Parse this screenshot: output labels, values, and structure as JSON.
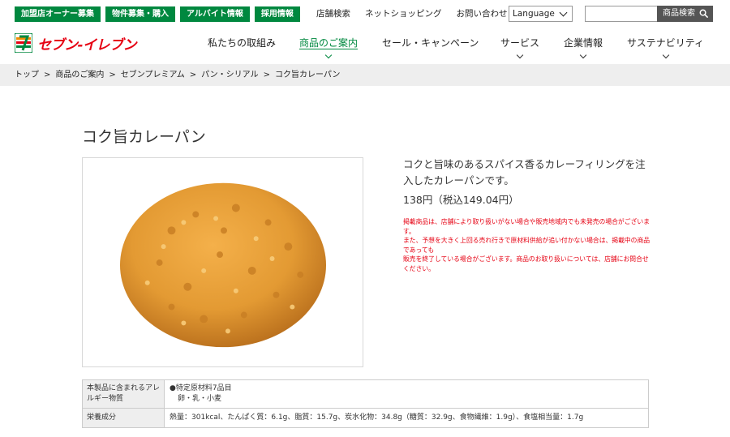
{
  "topbar": {
    "buttons": [
      "加盟店オーナー募集",
      "物件募集・購入",
      "アルバイト情報",
      "採用情報"
    ],
    "links": [
      "店舗検索",
      "ネットショッピング",
      "お問い合わせ"
    ],
    "language_label": "Language",
    "search_placeholder": "",
    "search_button_label": "商品検索"
  },
  "brand": {
    "logo_text": "セブン-イレブン",
    "logo_color": "#e60012",
    "accent_green": "#00883f"
  },
  "nav": {
    "items": [
      "私たちの取組み",
      "商品のご案内",
      "セール・キャンペーン",
      "サービス",
      "企業情報",
      "サステナビリティ"
    ],
    "active_index": 1
  },
  "breadcrumb": [
    "トップ",
    "商品のご案内",
    "セブンプレミアム",
    "パン・シリアル",
    "コク旨カレーパン"
  ],
  "product": {
    "title": "コク旨カレーパン",
    "description": "コクと旨味のあるスパイス香るカレーフィリングを注入したカレーパンです。",
    "price": "138円（税込149.04円）",
    "notes": [
      "掲載商品は、店舗により取り扱いがない場合や販売地域内でも未発売の場合がございます。",
      "また、予想を大きく上回る売れ行きで原材料供給が追い付かない場合は、掲載中の商品であっても",
      "販売を終了している場合がございます。商品のお取り扱いについては、店舗にお問合せください。"
    ]
  },
  "info_table": {
    "allergen_header": "本製品に含まれるアレルギー物質",
    "allergen_line1": "●特定原材料7品目",
    "allergen_line2": "卵・乳・小麦",
    "nutrition_header": "栄養成分",
    "nutrition_value": "熱量：301kcal、たんぱく質：6.1g、脂質：15.7g、炭水化物：34.8g（糖質：32.9g、食物繊維：1.9g）、食塩相当量：1.7g"
  }
}
